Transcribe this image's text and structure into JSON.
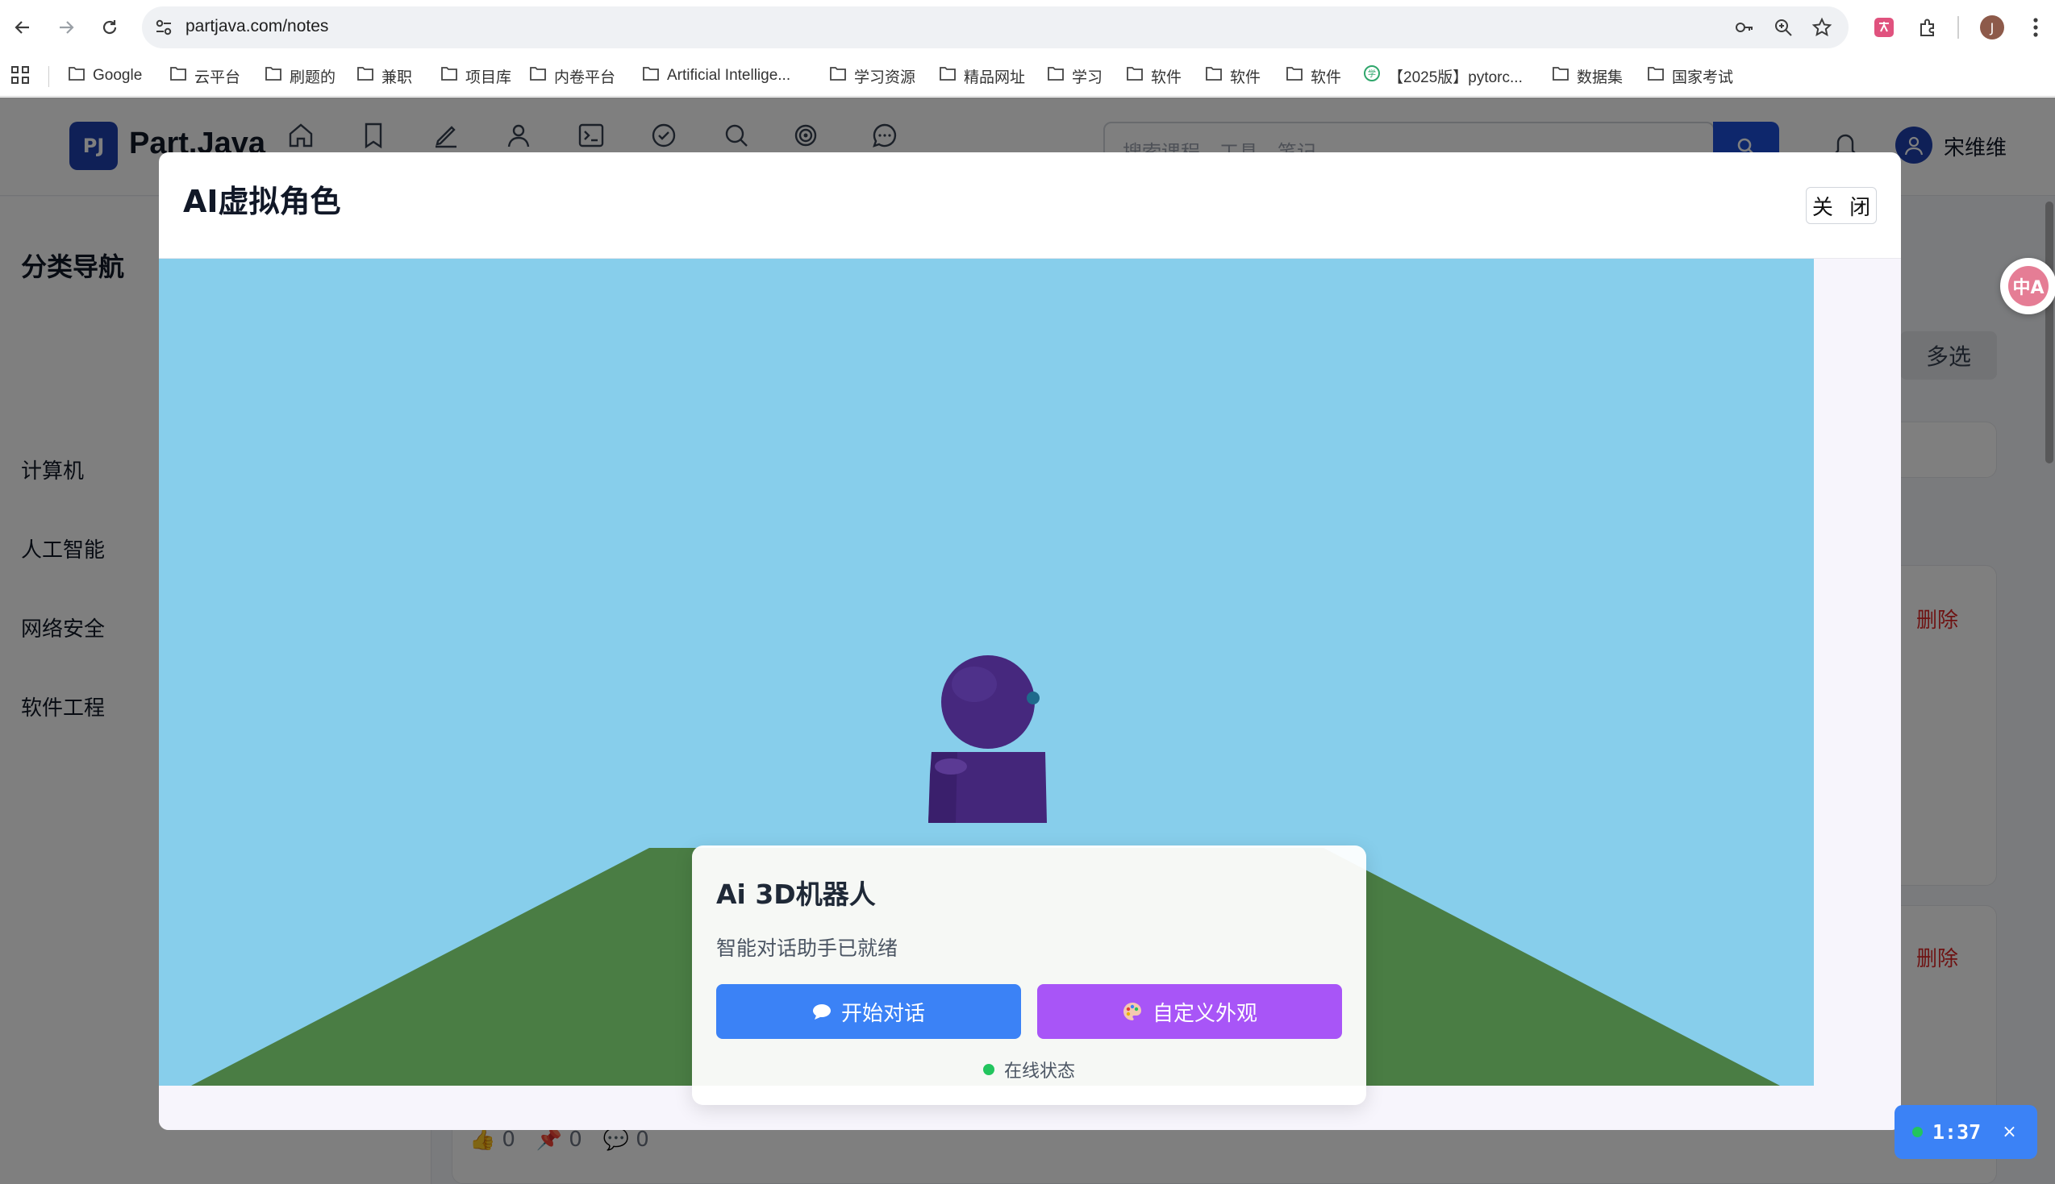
{
  "browser": {
    "url": "partjava.com/notes",
    "profile_initial": "J",
    "bookmarks": [
      "Google",
      "云平台",
      "刷题的",
      "兼职",
      "项目库",
      "内卷平台",
      "Artificial Intellige...",
      "学习资源",
      "精品网址",
      "学习",
      "软件",
      "软件",
      "软件",
      "【2025版】pytorc...",
      "数据集",
      "国家考试"
    ]
  },
  "site": {
    "logo_mark": "PJ",
    "logo_text": "Part.Java",
    "search_placeholder": "搜索课程、工具、笔记",
    "user_name": "宋维维",
    "sidebar_title": "分类导航",
    "sidebar_items": [
      "计算机",
      "人工智能",
      "网络安全",
      "软件工程"
    ],
    "multi_select_label": "多选",
    "delete_label": "删除",
    "stats": {
      "likes": "0",
      "favorites": "0",
      "comments": "0"
    }
  },
  "modal": {
    "title": "AI虚拟角色",
    "close_label": "关 闭",
    "card": {
      "title": "Ai 3D机器人",
      "subtitle": "智能对话助手已就绪",
      "chat_button": "开始对话",
      "customize_button": "自定义外观",
      "status_text": "在线状态"
    }
  },
  "timer": {
    "time": "1:37",
    "close_symbol": "×"
  },
  "translate_fab_label": "中A",
  "colors": {
    "sky": "#87ceeb",
    "ground": "#4a7d44",
    "robot": "#4a2a80",
    "chat_button": "#3b82f6",
    "customize_button": "#a855f7",
    "status_online": "#22c55e"
  }
}
